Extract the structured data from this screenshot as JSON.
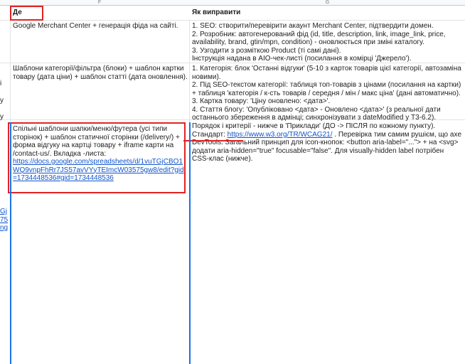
{
  "columns": {
    "f": "F",
    "g": "G"
  },
  "headers": {
    "where": "Де",
    "fix": "Як виправити"
  },
  "left_cutoff": {
    "row2_chars": [
      "і",
      "у",
      "у"
    ],
    "row3_chars": [
      "Gj",
      "75",
      "ng"
    ]
  },
  "rows": [
    {
      "where": "Google Merchant Center + генерація фіда на сайті.",
      "fix_lines": [
        "1. SEO: створити/перевірити акаунт Merchant Center, підтвердити домен.",
        "2. Розробник: автогенерований фід (id, title, description, link, image_link, price, availability, brand, gtin/mpn, condition) - оновлюється при зміні каталогу.",
        "3. Узгодити з розміткою Product (ті самі дані).",
        "Інструкція надана в AIO-чек-листі (посилання в комірці 'Джерело')."
      ]
    },
    {
      "where": "Шаблони категорії/фільтра (блоки) + шаблон картки товару (дата ціни) + шаблон статті (дата оновлення).",
      "fix_lines": [
        "1. Категорія: блок 'Останні відгуки' (5-10 з карток товарів цієї категорії, автозаміна новими).",
        "2. Під SEO-текстом категорії: таблиця топ-товарів з цінами (посилання на картки) + таблиця 'категорія / к-сть товарів / середня / мін / макс ціна' (дані автоматично).",
        "3. Картка товару: 'Ціну оновлено: <дата>'.",
        "4. Стаття блогу: 'Опубліковано <дата> - Оновлено <дата>' (з реальної дати останнього збереження в адмінці; синхронізувати з dateModified у T3-6.2)."
      ]
    },
    {
      "where_text": "Спільні шаблони шапки/меню/футера (усі типи сторінок) + шаблон статичної сторінки (/delivery/) + форма відгуку на картці товару + iframe карти на /contact-us/.  Вкладка -листа:",
      "where_link": "https://docs.google.com/spreadsheets/d/1vuTGjCBO1WQ9vnpFhRr7JS57avVYyTEImcW03575gw8/edit?gid=1734448536#gid=1734448536",
      "fix_part1": "Порядок і критерії - нижче в 'Приклади' (ДО -> ПІСЛЯ по кожному пункту). Стандарт: ",
      "fix_link": "https://www.w3.org/TR/WCAG21/",
      "fix_part2": " . Перевірка тим самим рушієм, що axe DevTools. Загальний принцип для icon-кнопок: <button aria-label=\"...\"> + на <svg> додати aria-hidden=\"true\" focusable=\"false\". Для visually-hidden label потрібен CSS-клас (нижче)."
    }
  ],
  "annotation_colors": {
    "red": "#e02424",
    "blue": "#1a73e8"
  }
}
